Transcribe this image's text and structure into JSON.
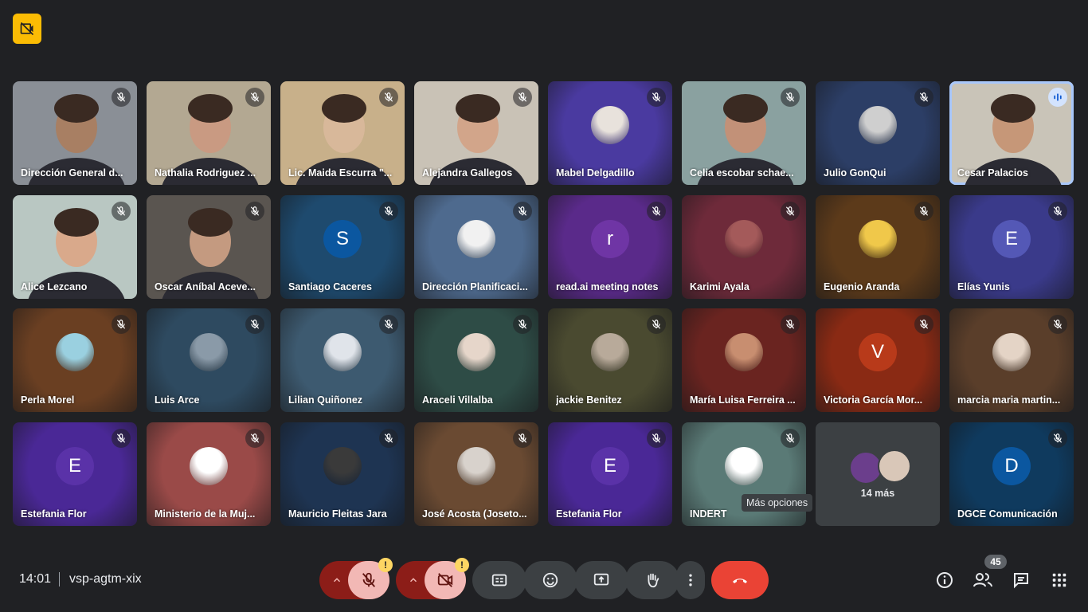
{
  "meeting": {
    "time": "14:01",
    "code": "vsp-agtm-xix",
    "participant_count": "45",
    "more_label": "14 más",
    "tooltip": "Más opciones"
  },
  "colors": {
    "background": "#202124",
    "end_call": "#ea4335",
    "muted_control": "#8c1d18",
    "warning": "#fdd663",
    "speaking_border": "#a8c7fa"
  },
  "icons": {
    "top_badge": "recording-off-icon",
    "tile_mic": "mic-off-icon",
    "speaking": "audio-wave-icon",
    "controls": [
      "chevron-up-icon",
      "mic-off-icon",
      "chevron-up-icon",
      "camera-off-icon",
      "closed-captions-icon",
      "emoji-icon",
      "present-screen-icon",
      "raise-hand-icon",
      "more-vertical-icon",
      "end-call-icon"
    ],
    "right": [
      "info-icon",
      "people-icon",
      "chat-icon",
      "apps-icon"
    ]
  },
  "participants": [
    {
      "name": "Dirección General d...",
      "kind": "video",
      "bg": "#8a8f96",
      "skin": "#a87f63"
    },
    {
      "name": "Nathalia Rodriguez ...",
      "kind": "video",
      "bg": "#b3a892",
      "skin": "#c99a82"
    },
    {
      "name": "Lic. Maida Escurra \"...",
      "kind": "video",
      "bg": "#c8b08a",
      "skin": "#d8b89a"
    },
    {
      "name": "Alejandra Gallegos",
      "kind": "video",
      "bg": "#c9c2b6",
      "skin": "#d2a58a"
    },
    {
      "name": "Mabel Delgadillo",
      "kind": "photo",
      "bg": "#4a3aa0",
      "av": "#e8e2dc"
    },
    {
      "name": "Celia escobar schae...",
      "kind": "video",
      "bg": "#8aa1a0",
      "skin": "#c29178"
    },
    {
      "name": "Julio GonQui",
      "kind": "photo",
      "bg": "#2c3e66",
      "av": "#cfcfcf"
    },
    {
      "name": "Cesar Palacios",
      "kind": "video",
      "bg": "#c9c4b8",
      "skin": "#c69778",
      "speaking": true
    },
    {
      "name": "Alice Lezcano",
      "kind": "video",
      "bg": "#b9c7c2",
      "skin": "#d9a98b"
    },
    {
      "name": "Oscar Aníbal Aceve...",
      "kind": "video",
      "bg": "#5a5550",
      "skin": "#c49a80"
    },
    {
      "name": "Santiago Caceres",
      "kind": "letter",
      "letter": "S",
      "bg": "#1e4a6e",
      "av": "#0b57a0"
    },
    {
      "name": "Dirección Planificaci...",
      "kind": "photo",
      "bg": "#4e6a8e",
      "av": "#f1f1f1"
    },
    {
      "name": "read.ai meeting notes",
      "kind": "letter",
      "letter": "r",
      "bg": "#5a2a8a",
      "av": "#6f35a5"
    },
    {
      "name": "Karimi Ayala",
      "kind": "photo",
      "bg": "#6e2a3a",
      "av": "#a45a5a"
    },
    {
      "name": "Eugenio Aranda",
      "kind": "photo",
      "bg": "#5c3a1a",
      "av": "#f0c84a"
    },
    {
      "name": "Elías Yunis",
      "kind": "letter",
      "letter": "E",
      "bg": "#3a3a8a",
      "av": "#5458b6"
    },
    {
      "name": "Perla Morel",
      "kind": "photo",
      "bg": "#6a3f22",
      "av": "#9ad0e0"
    },
    {
      "name": "Luis Arce",
      "kind": "photo",
      "bg": "#2e4a60",
      "av": "#8a9aa8"
    },
    {
      "name": "Lilian Quiñonez",
      "kind": "photo",
      "bg": "#3d5a70",
      "av": "#e0e4ea"
    },
    {
      "name": "Araceli Villalba",
      "kind": "photo",
      "bg": "#2e4c46",
      "av": "#e6d6ca"
    },
    {
      "name": "jackie Benitez",
      "kind": "photo",
      "bg": "#4a4a30",
      "av": "#b8aa9a"
    },
    {
      "name": "María Luisa Ferreira ...",
      "kind": "photo",
      "bg": "#6a2420",
      "av": "#c88e70"
    },
    {
      "name": "Victoria García Mor...",
      "kind": "letter",
      "letter": "V",
      "bg": "#8a2a14",
      "av": "#b83a1a"
    },
    {
      "name": "marcia maria martin...",
      "kind": "photo",
      "bg": "#5a3e2a",
      "av": "#e4d4c6"
    },
    {
      "name": "Estefania Flor",
      "kind": "letter",
      "letter": "E",
      "bg": "#4a2896",
      "av": "#5a32a8"
    },
    {
      "name": "Ministerio de la Muj...",
      "kind": "photo",
      "bg": "#9a4a48",
      "av": "#ffffff"
    },
    {
      "name": "Mauricio Fleitas Jara",
      "kind": "photo",
      "bg": "#1e3452",
      "av": "#3a3a3a"
    },
    {
      "name": "José Acosta (Joseto...",
      "kind": "photo",
      "bg": "#6a4a32",
      "av": "#d8d2cc"
    },
    {
      "name": "Estefania Flor",
      "kind": "letter",
      "letter": "E",
      "bg": "#4a2896",
      "av": "#5a32a8"
    },
    {
      "name": "INDERT",
      "kind": "photo",
      "bg": "#5a7a76",
      "av": "#ffffff"
    },
    {
      "name": "",
      "kind": "more",
      "bg": "#3c4043"
    },
    {
      "name": "DGCE Comunicación",
      "kind": "letter",
      "letter": "D",
      "bg": "#0f3a5e",
      "av": "#0b57a0"
    }
  ]
}
